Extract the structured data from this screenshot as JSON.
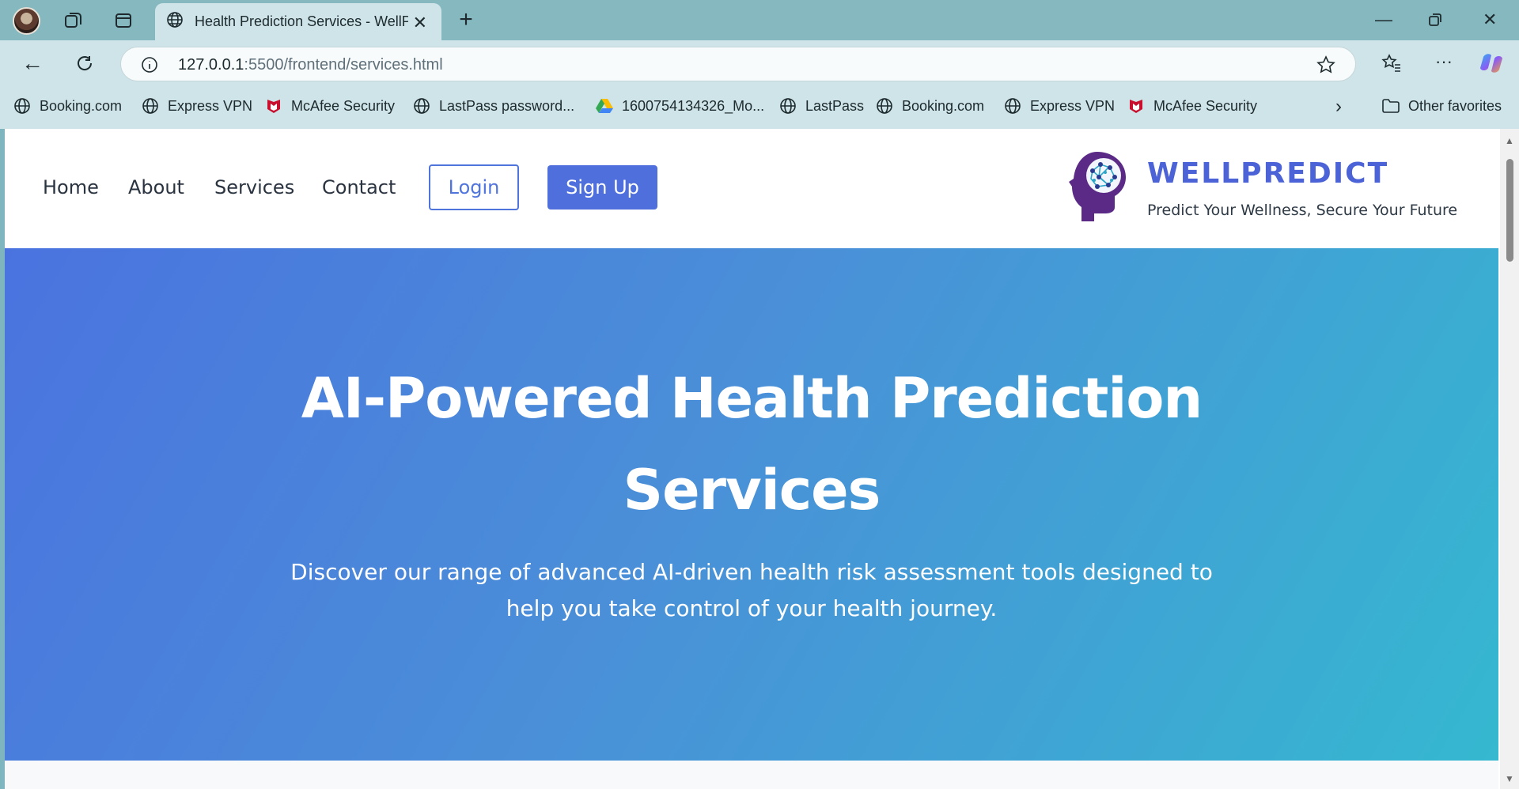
{
  "browser": {
    "tab": {
      "title": "Health Prediction Services - WellPredict"
    },
    "address": {
      "host": "127.0.0.1",
      "path": ":5500/frontend/services.html"
    },
    "favorites": [
      {
        "label": "Booking.com",
        "icon": "globe-icon"
      },
      {
        "label": "Express VPN",
        "icon": "globe-icon"
      },
      {
        "label": "McAfee Security",
        "icon": "mcafee-icon"
      },
      {
        "label": "LastPass password...",
        "icon": "globe-icon"
      },
      {
        "label": "1600754134326_Mo...",
        "icon": "google-drive-icon"
      },
      {
        "label": "LastPass",
        "icon": "globe-icon"
      },
      {
        "label": "Booking.com",
        "icon": "globe-icon"
      },
      {
        "label": "Express VPN",
        "icon": "globe-icon"
      },
      {
        "label": "McAfee Security",
        "icon": "mcafee-icon"
      }
    ],
    "other_favorites": "Other favorites"
  },
  "site": {
    "nav": {
      "home": "Home",
      "about": "About",
      "services": "Services",
      "contact": "Contact",
      "login": "Login",
      "signup": "Sign Up"
    },
    "brand": {
      "name": "WELLPREDICT",
      "tagline": "Predict Your Wellness, Secure Your Future"
    },
    "hero": {
      "title_line1": "AI-Powered Health Prediction",
      "title_line2": "Services",
      "subtitle_line1": "Discover our range of advanced AI-driven health risk assessment tools designed to",
      "subtitle_line2": "help you take control of your health journey."
    }
  },
  "colors": {
    "accent": "#4f6fdd",
    "hero_gradient_start": "#4a73df",
    "hero_gradient_end": "#35b8d0"
  }
}
